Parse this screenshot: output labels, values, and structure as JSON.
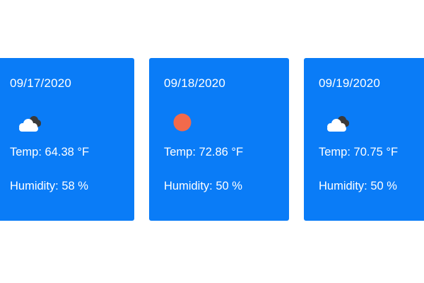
{
  "forecast": [
    {
      "date": "09/17/2020",
      "icon": "cloudy-icon",
      "temp": "Temp: 64.38 °F",
      "humidity": "Humidity: 58 %"
    },
    {
      "date": "09/18/2020",
      "icon": "sun-icon",
      "temp": "Temp: 72.86 °F",
      "humidity": "Humidity: 50 %"
    },
    {
      "date": "09/19/2020",
      "icon": "cloudy-icon",
      "temp": "Temp: 70.75 °F",
      "humidity": "Humidity: 50 %"
    }
  ],
  "colors": {
    "card_background": "#0a7cf7",
    "text": "#ffffff",
    "sun": "#f26a4b",
    "cloud_front": "#ffffff",
    "cloud_back": "#3a3a3a"
  }
}
